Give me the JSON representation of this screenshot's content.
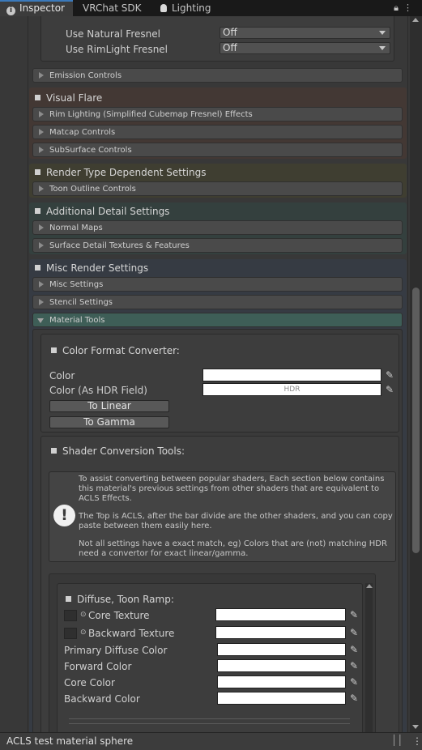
{
  "tabs": [
    {
      "label": "Inspector",
      "icon": "info-icon",
      "active": true
    },
    {
      "label": "VRChat SDK",
      "active": false
    },
    {
      "label": "Lighting",
      "icon": "bulb-icon",
      "active": false
    }
  ],
  "tabbar_icons": {
    "lock": "lock-icon",
    "menu": "kebab-menu-icon"
  },
  "fresnel": {
    "natural_label": "Use Natural Fresnel",
    "natural_value": "Off",
    "rim_label": "Use RimLight Fresnel",
    "rim_value": "Off"
  },
  "foldouts": {
    "emission": "Emission Controls",
    "rim_lighting": "Rim Lighting (Simplified Cubemap Fresnel) Effects",
    "matcap": "Matcap Controls",
    "subsurface": "SubSurface Controls",
    "toon_outline": "Toon Outline Controls",
    "normal_maps": "Normal Maps",
    "surface_detail": "Surface Detail Textures & Features",
    "misc_settings": "Misc Settings",
    "stencil": "Stencil Settings",
    "material_tools": "Material Tools"
  },
  "sections": {
    "visual_flare": "Visual Flare",
    "render_type": "Render Type Dependent Settings",
    "additional_detail": "Additional Detail Settings",
    "misc_render": "Misc Render Settings"
  },
  "section_colors": {
    "visual_flare": "#433834",
    "render_type": "#3f3e31",
    "additional_detail": "#34403e",
    "misc_render": "#363b43"
  },
  "color_converter": {
    "title": "Color Format Converter:",
    "color_label": "Color",
    "hdr_label": "Color (As HDR Field)",
    "hdr_tag": "HDR",
    "to_linear": "To Linear",
    "to_gamma": "To Gamma"
  },
  "shader_conversion": {
    "title": "Shader Conversion Tools:",
    "help_p1": "To assist converting between popular shaders, Each section below contains this material's previous settings from other shaders that are equivalent to ACLS Effects.",
    "help_p2": "The Top is ACLS, after the bar divide are the other shaders, and you can copy paste between them easily here.",
    "help_p3": "Not all settings have a exact match, eg) Colors that are (not) matching HDR need a convertor for exact linear/gamma."
  },
  "diffuse": {
    "title": "Diffuse, Toon Ramp:",
    "core_texture": "Core Texture",
    "backward_texture": "Backward Texture",
    "primary_diffuse": "Primary Diffuse Color",
    "forward_color": "Forward Color",
    "core_color": "Core Color",
    "backward_color": "Backward Color"
  },
  "footer": {
    "title": "ACLS test material sphere"
  }
}
